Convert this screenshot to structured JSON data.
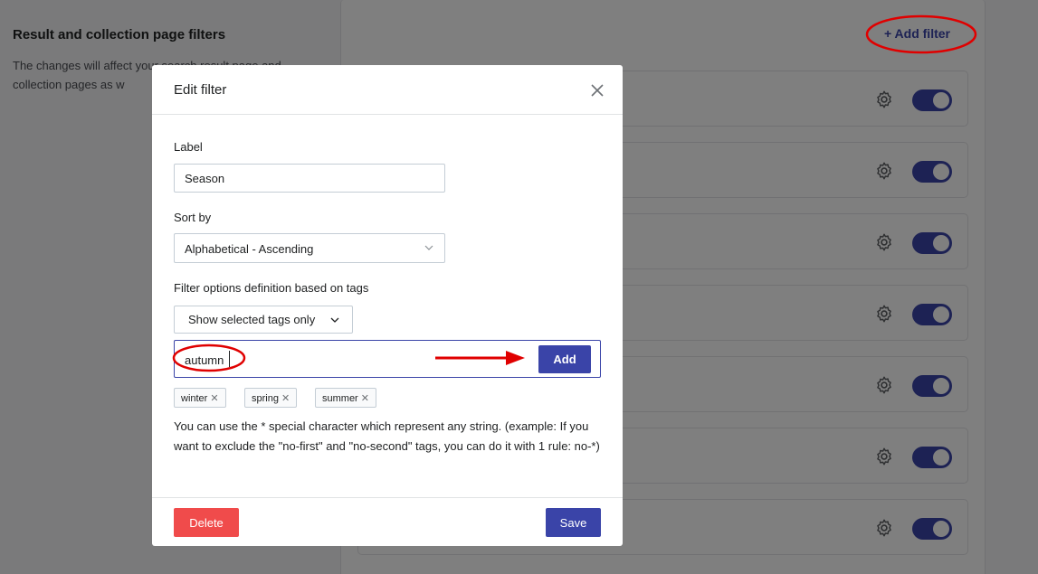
{
  "page": {
    "title": "Result and collection page filters",
    "description": "The changes will affect your search result page and collection pages as w",
    "add_filter_label": "+ Add filter",
    "accent_color": "#3a44a8"
  },
  "modal": {
    "title": "Edit filter",
    "label_field": {
      "label": "Label",
      "value": "Season"
    },
    "sort_field": {
      "label": "Sort by",
      "value": "Alphabetical - Ascending"
    },
    "tags_section": {
      "label": "Filter options definition based on tags",
      "mode_button": "Show selected tags only",
      "input_value": "autumn",
      "add_label": "Add",
      "tags": [
        "winter",
        "spring",
        "summer"
      ]
    },
    "help_text": "You can use the * special character which represent any string. (example: If you want to exclude the \"no-first\" and \"no-second\" tags, you can do it with 1 rule: no-*)",
    "delete_label": "Delete",
    "save_label": "Save",
    "delete_color": "#f04b4b"
  }
}
